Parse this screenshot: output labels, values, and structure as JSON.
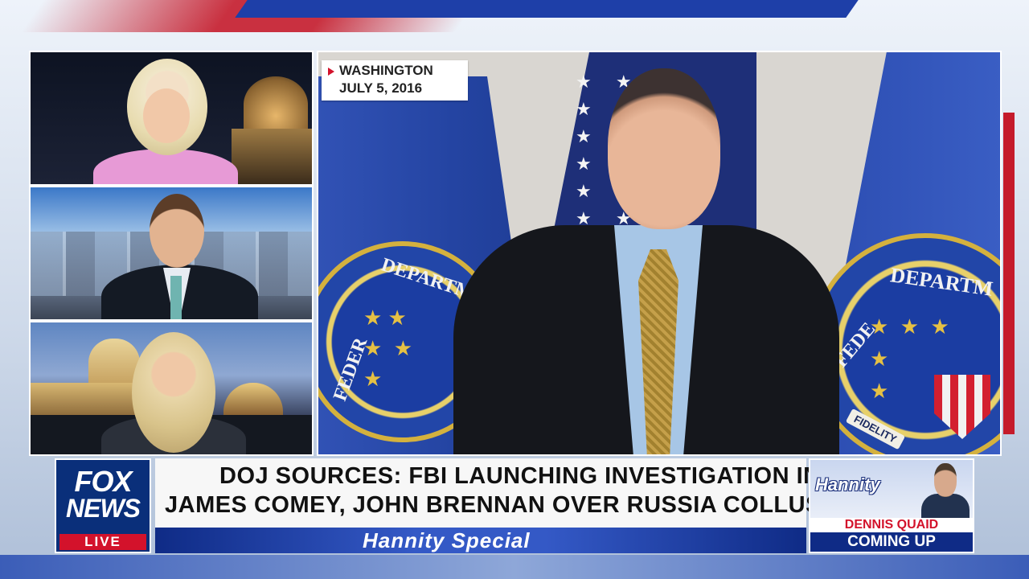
{
  "dateline": {
    "location": "WASHINGTON",
    "date": "JULY 5, 2016"
  },
  "fbi_seal": {
    "text_depart_left": "DEPARTM",
    "text_federal_left": "FEDER",
    "text_depart_right": "DEPARTM",
    "text_federal_right": "FEDE",
    "text_fidelity": "FIDELITY"
  },
  "network_logo": {
    "line1": "FOX",
    "line2": "NEWS",
    "live": "LIVE"
  },
  "headline": {
    "line1": "DOJ SOURCES: FBI LAUNCHING INVESTIGATION INTO",
    "line2": "JAMES COMEY, JOHN BRENNAN OVER RUSSIA COLLUSION HOAX"
  },
  "show_bar": {
    "title": "Hannity Special"
  },
  "promo": {
    "show": "Hannity",
    "guest": "DENNIS QUAID",
    "status": "COMING UP"
  },
  "colors": {
    "fox_blue": "#0a2f7a",
    "fox_red": "#d3122b",
    "fbi_flag": "#2a4fb6",
    "gold": "#c9a23a",
    "bar_blue": "#1a3a9a"
  }
}
